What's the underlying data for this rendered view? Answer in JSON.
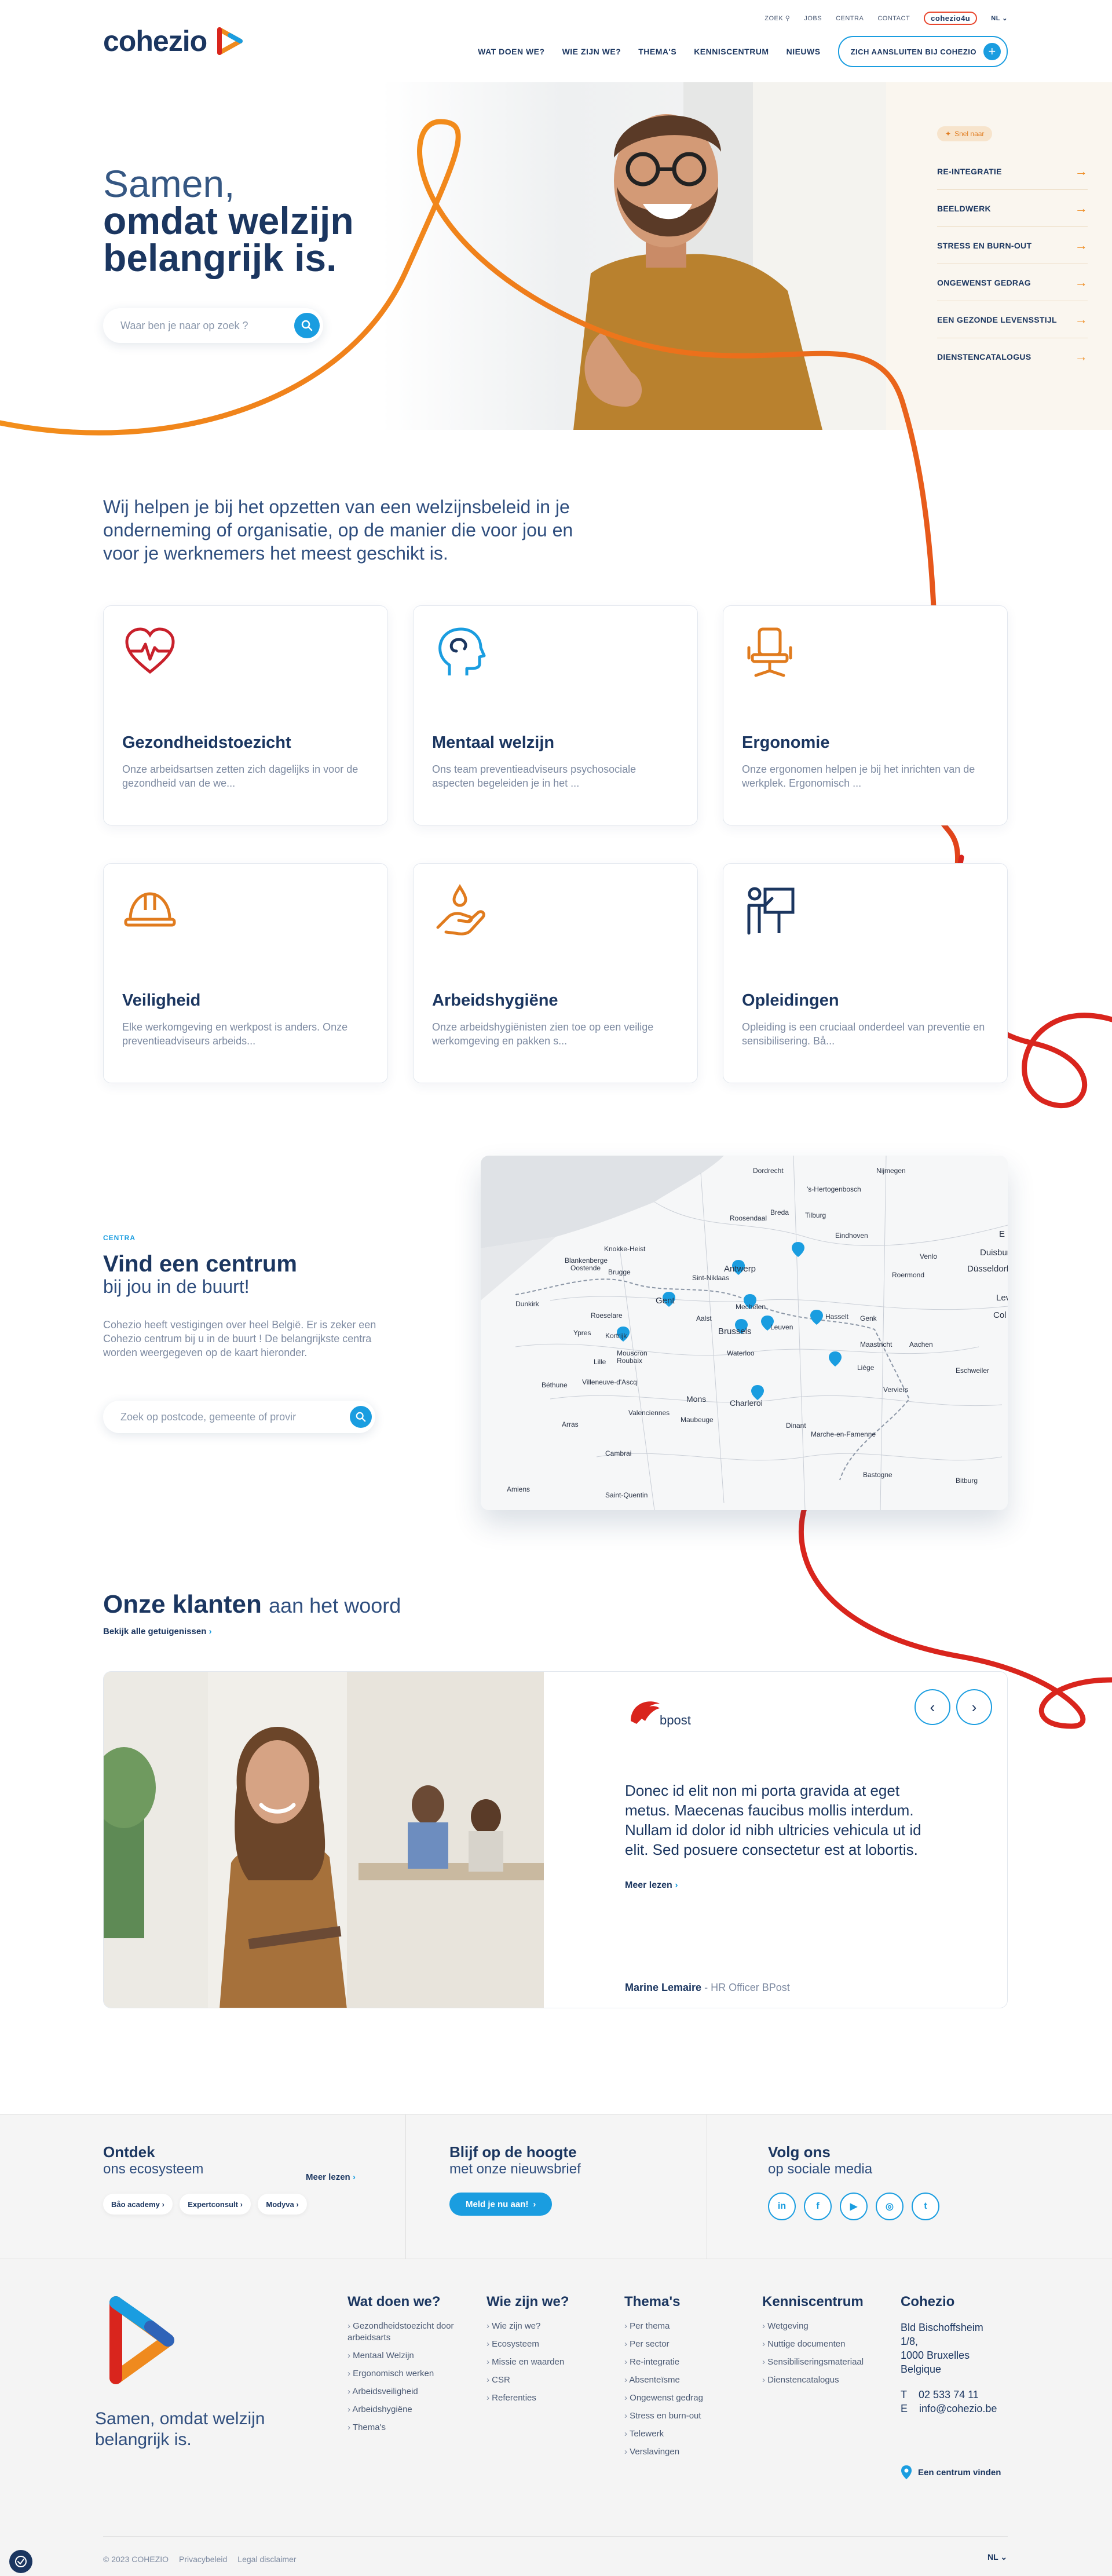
{
  "brand": {
    "name": "cohezio",
    "colors": {
      "navy": "#1b3660",
      "blue": "#1a9de0",
      "orange": "#ef8a1e",
      "red": "#d9251d"
    }
  },
  "utility_nav": {
    "search": "ZOEK",
    "jobs": "JOBS",
    "centra": "CENTRA",
    "contact": "CONTACT",
    "cohezio4u": "cohezio4u",
    "lang": "NL"
  },
  "main_nav": {
    "items": [
      "WAT DOEN WE?",
      "WIE ZIJN WE?",
      "THEMA'S",
      "KENNISCENTRUM",
      "NIEUWS"
    ],
    "join_button": "ZICH AANSLUITEN BIJ COHEZIO"
  },
  "hero": {
    "title_line1": "Samen,",
    "title_line2": "omdat welzijn",
    "title_line3": "belangrijk is.",
    "search_placeholder": "Waar ben je naar op zoek ?"
  },
  "quick_links": {
    "badge": "Snel naar",
    "items": [
      "RE-INTEGRATIE",
      "BEELDWERK",
      "STRESS EN BURN-OUT",
      "ONGEWENST GEDRAG",
      "EEN GEZONDE LEVENSSTIJL",
      "DIENSTENCATALOGUS"
    ]
  },
  "intro": "Wij helpen je bij het opzetten van een welzijnsbeleid in je onderneming of organisatie, op de manier die voor jou en voor je werknemers het meest geschikt is.",
  "services": [
    {
      "title": "Gezondheidstoezicht",
      "text": "Onze arbeidsartsen zetten zich dagelijks in voor de gezondheid van de we...",
      "icon": "heart-pulse-icon"
    },
    {
      "title": "Mentaal welzijn",
      "text": "Ons team preventieadviseurs psychosociale aspecten begeleiden je in het ...",
      "icon": "head-mind-icon"
    },
    {
      "title": "Ergonomie",
      "text": "Onze ergonomen helpen je bij het inrichten van de werkplek. Ergonomisch ...",
      "icon": "office-chair-icon"
    },
    {
      "title": "Veiligheid",
      "text": "Elke werkomgeving en werkpost is anders. Onze preventieadviseurs arbeids...",
      "icon": "hard-hat-icon"
    },
    {
      "title": "Arbeidshygiëne",
      "text": "Onze arbeidshygiënisten zien toe op een veilige werkomgeving en pakken s...",
      "icon": "hand-drop-icon"
    },
    {
      "title": "Opleidingen",
      "text": "Opleiding is een cruciaal onderdeel van preventie en sensibilisering. Bå...",
      "icon": "teacher-board-icon"
    }
  ],
  "centra": {
    "label": "CENTRA",
    "title": "Vind een centrum",
    "subtitle": "bij jou in de buurt!",
    "body": "Cohezio heeft vestigingen over heel België. Er is zeker een Cohezio centrum bij u in de buurt ! De belangrijkste centra worden weergegeven op de kaart hieronder.",
    "search_placeholder": "Zoek op postcode, gemeente of provir",
    "map_cities": [
      "Dordrecht",
      "'s-Hertogenbosch",
      "Nijmegen",
      "Breda",
      "Tilburg",
      "Eindhoven",
      "Roosendaal",
      "Venlo",
      "Knokke-Heist",
      "Blankenberge",
      "Oostende",
      "Brugge",
      "Antwerp",
      "Sint-Niklaas",
      "Roermond",
      "Duisburg",
      "Düsseldorf",
      "Dunkirk",
      "Gent",
      "Aalst",
      "Mechelen",
      "Hasselt",
      "Genk",
      "Roeselare",
      "Ypres",
      "Kortrijk",
      "Brussels",
      "Leuven",
      "Maastricht",
      "Aachen",
      "Mouscron",
      "Lille",
      "Roubaix",
      "Waterloo",
      "Liège",
      "Eschweiler",
      "Béthune",
      "Villeneuve-d'Ascq",
      "Mons",
      "Charleroi",
      "Verviers",
      "Valenciennes",
      "Maubeuge",
      "Arras",
      "Dinant",
      "Marche-en-Famenne",
      "Cambrai",
      "Bastogne",
      "Amiens",
      "Saint-Quentin",
      "Bitburg",
      "Lev",
      "Col",
      "E"
    ]
  },
  "testimonials": {
    "title_bold": "Onze klanten",
    "title_rest": "aan het woord",
    "all_link": "Bekijk alle getuigenissen",
    "company": "bpost",
    "quote": "Donec id elit non mi porta gravida at eget metus. Maecenas faucibus mollis interdum. Nullam id dolor id nibh ultricies vehicula ut id elit. Sed posuere consectetur est at lobortis.",
    "read_more": "Meer lezen",
    "author_name": "Marine Lemaire",
    "author_role": "- HR Officer BPost"
  },
  "ecosystem": {
    "title": "Ontdek",
    "subtitle": "ons ecosysteem",
    "more": "Meer lezen",
    "pills": [
      "Båo academy",
      "Expertconsult",
      "Modyva"
    ]
  },
  "newsletter": {
    "title": "Blijf op de hoogte",
    "subtitle": "met onze nieuwsbrief",
    "button": "Meld je nu aan!"
  },
  "social": {
    "title": "Volg ons",
    "subtitle": "op sociale media",
    "networks": [
      "in",
      "f",
      "▶",
      "◎",
      "t"
    ]
  },
  "footer": {
    "tagline": "Samen, omdat welzijn belangrijk is.",
    "columns": [
      {
        "title": "Wat doen we?",
        "items": [
          "Gezondheidstoezicht door arbeidsarts",
          "Mentaal Welzijn",
          "Ergonomisch werken",
          "Arbeidsveiligheid",
          "Arbeidshygiëne",
          "Thema's"
        ]
      },
      {
        "title": "Wie zijn we?",
        "items": [
          "Wie zijn we?",
          "Ecosysteem",
          "Missie en waarden",
          "CSR",
          "Referenties"
        ]
      },
      {
        "title": "Thema's",
        "items": [
          "Per thema",
          "Per sector",
          "Re-integratie",
          "Absenteïsme",
          "Ongewenst gedrag",
          "Stress en burn-out",
          "Telewerk",
          "Verslavingen"
        ]
      },
      {
        "title": "Kenniscentrum",
        "items": [
          "Wetgeving",
          "Nuttige documenten",
          "Sensibiliseringsmateriaal",
          "Dienstencatalogus"
        ]
      }
    ],
    "contact_title": "Cohezio",
    "address_line1": "Bld Bischoffsheim",
    "address_line2": "1/8,",
    "address_line3": "1000 Bruxelles",
    "address_line4": "Belgique",
    "phone_label": "T",
    "phone": "02 533 74 11",
    "email_label": "E",
    "email": "info@cohezio.be",
    "find_center": "Een centrum vinden",
    "copyright": "© 2023 COHEZIO",
    "privacy": "Privacybeleid",
    "legal": "Legal disclaimer",
    "lang": "NL"
  }
}
